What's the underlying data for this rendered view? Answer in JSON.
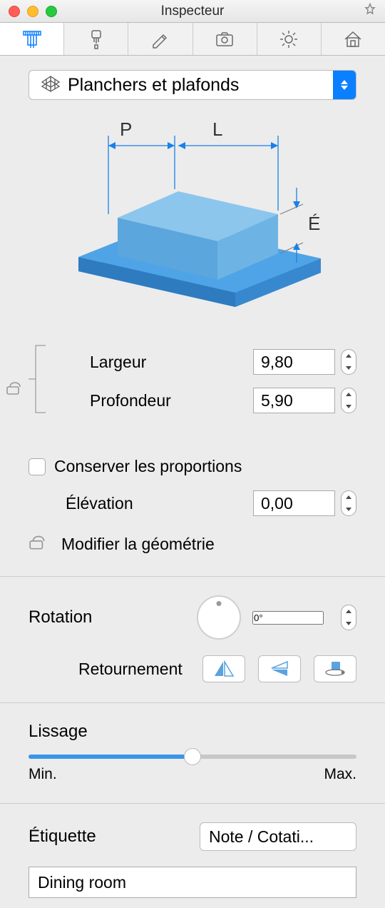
{
  "window": {
    "title": "Inspecteur"
  },
  "category": {
    "selected": "Planchers et plafonds"
  },
  "diagram": {
    "labels": {
      "p": "P",
      "l": "L",
      "e": "É"
    }
  },
  "dims": {
    "largeur": {
      "label": "Largeur",
      "value": "9,80"
    },
    "profondeur": {
      "label": "Profondeur",
      "value": "5,90"
    },
    "proportions_label": "Conserver les proportions",
    "elevation": {
      "label": "Élévation",
      "value": "0,00"
    },
    "modify_label": "Modifier la géométrie"
  },
  "rotation": {
    "title": "Rotation",
    "value": "0°",
    "flip_label": "Retournement"
  },
  "smoothing": {
    "title": "Lissage",
    "min": "Min.",
    "max": "Max."
  },
  "etiquette": {
    "title": "Étiquette",
    "selected": "Note / Cotati...",
    "value": "Dining room"
  }
}
